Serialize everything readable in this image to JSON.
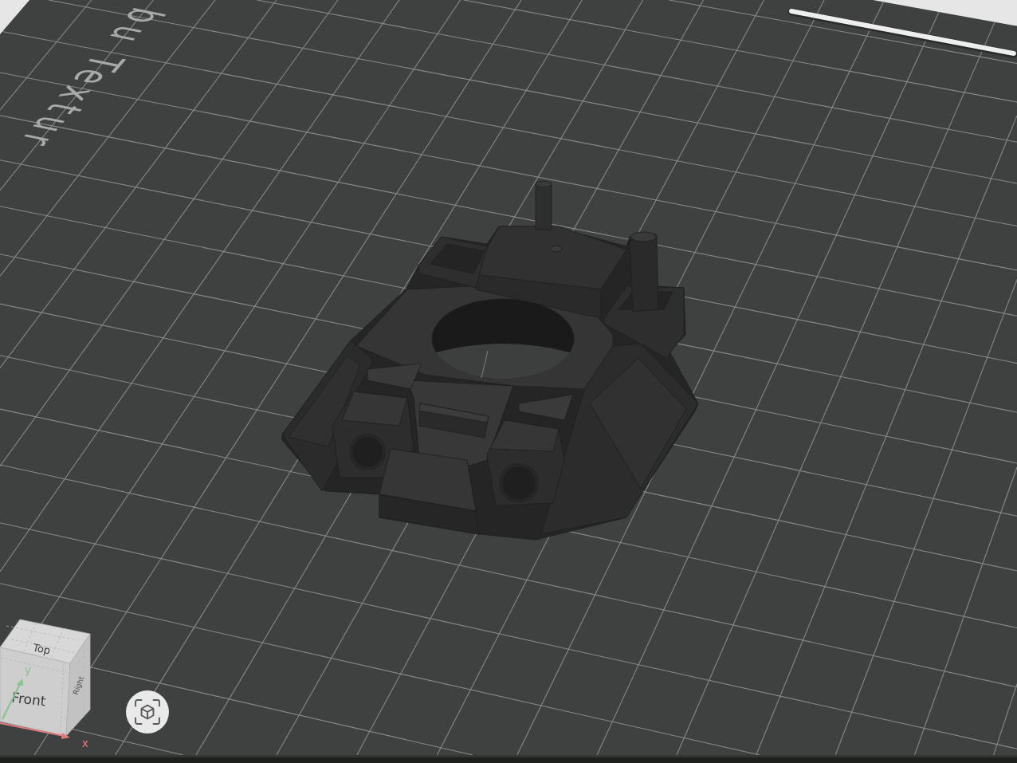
{
  "plate": {
    "label": "bu Textur"
  },
  "view_cube": {
    "faces": [
      {
        "kind": "top",
        "label": "Top"
      },
      {
        "kind": "front",
        "label": "Front"
      },
      {
        "kind": "right",
        "label": "Right"
      }
    ],
    "axes": [
      {
        "kind": "y",
        "label": "y"
      },
      {
        "kind": "x",
        "label": "x"
      }
    ]
  }
}
